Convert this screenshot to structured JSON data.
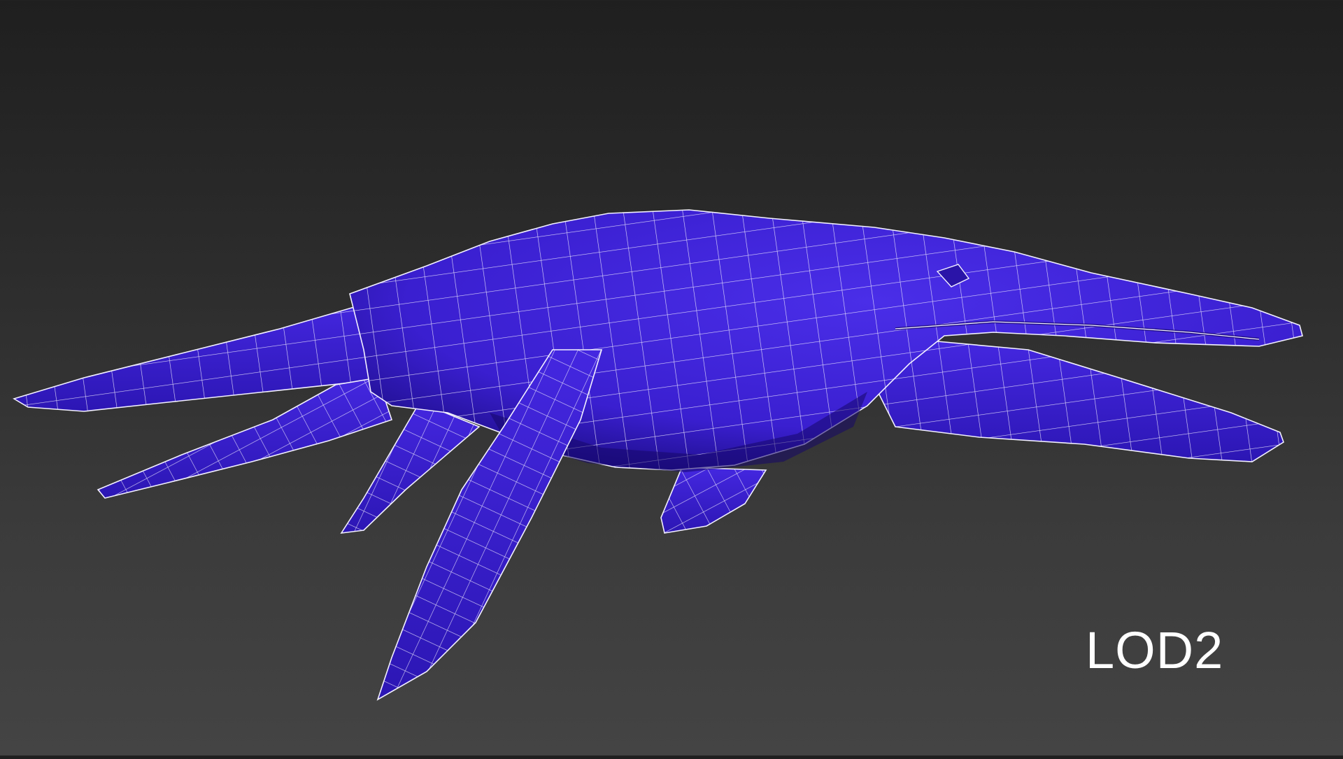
{
  "viewport": {
    "background_top": "#1f1f1f",
    "background_bottom": "#444444",
    "mesh_color": "#3a1fd0",
    "mesh_color_dark": "#1e0e8a",
    "wire_color": "#f2f0ff"
  },
  "label": {
    "text": "LOD2"
  }
}
